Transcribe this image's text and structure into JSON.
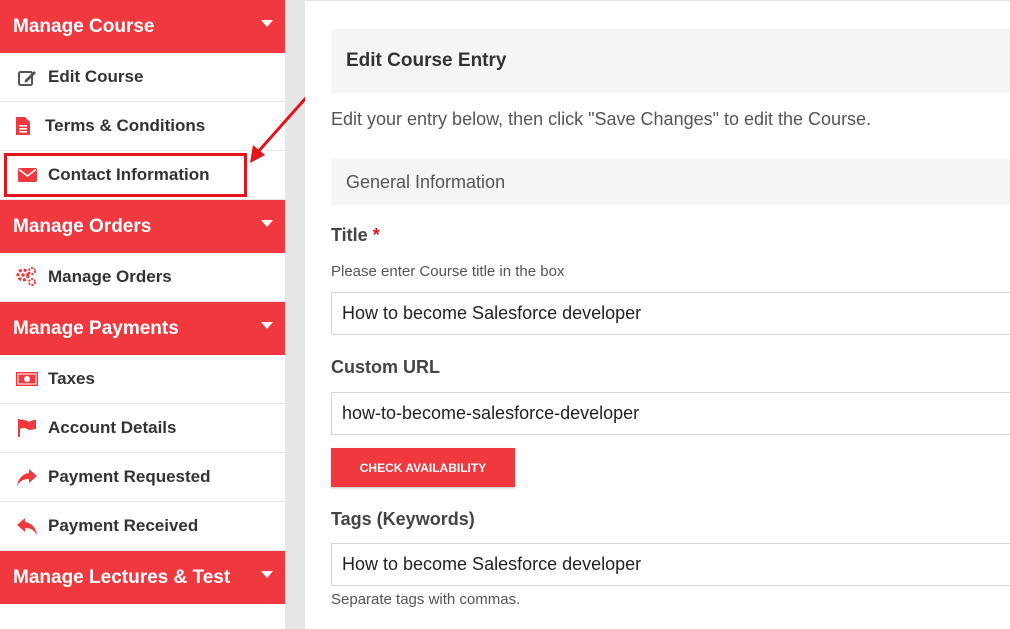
{
  "colors": {
    "accent": "#f0393f",
    "highlight": "#e3151a"
  },
  "sidebar": {
    "sections": [
      {
        "title": "Manage Course",
        "items": [
          {
            "label": "Edit Course",
            "icon": "edit-icon"
          },
          {
            "label": "Terms & Conditions",
            "icon": "document-icon"
          },
          {
            "label": "Contact Information",
            "icon": "envelope-icon"
          }
        ]
      },
      {
        "title": "Manage Orders",
        "items": [
          {
            "label": "Manage Orders",
            "icon": "gears-icon"
          }
        ]
      },
      {
        "title": "Manage Payments",
        "items": [
          {
            "label": "Taxes",
            "icon": "money-icon"
          },
          {
            "label": "Account Details",
            "icon": "flag-icon"
          },
          {
            "label": "Payment Requested",
            "icon": "share-icon"
          },
          {
            "label": "Payment Received",
            "icon": "reply-icon"
          }
        ]
      },
      {
        "title": "Manage Lectures & Test",
        "items": []
      }
    ]
  },
  "main": {
    "panel_title": "Edit Course Entry",
    "intro": "Edit your entry below, then click \"Save Changes\" to edit the Course.",
    "section_title": "General Information",
    "title_label": "Title",
    "required_mark": "*",
    "title_help": "Please enter Course title in the box",
    "title_value": "How to become Salesforce developer",
    "url_label": "Custom URL",
    "url_value": "how-to-become-salesforce-developer",
    "check_button": "CHECK AVAILABILITY",
    "tags_label": "Tags (Keywords)",
    "tags_value": "How to become Salesforce developer",
    "tags_help": "Separate tags with commas."
  }
}
